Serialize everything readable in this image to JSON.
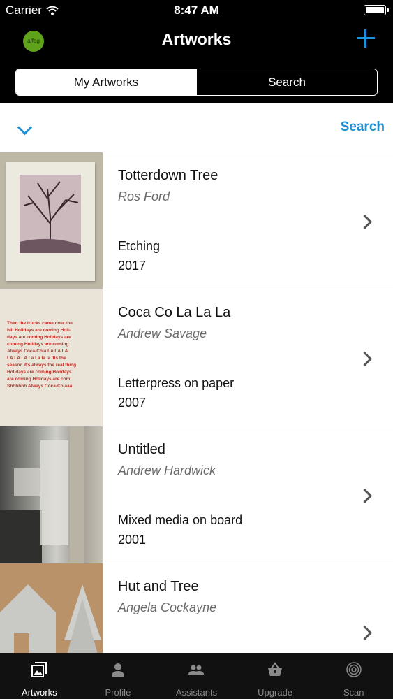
{
  "status_bar": {
    "carrier": "Carrier",
    "time": "8:47 AM"
  },
  "nav": {
    "logo_text": "a/fag",
    "title": "Artworks",
    "segments": [
      "My Artworks",
      "Search"
    ],
    "accent_color": "#1e8fd0"
  },
  "filter_row": {
    "search_label": "Search"
  },
  "artworks": [
    {
      "title": "Totterdown Tree",
      "artist": "Ros Ford",
      "medium": "Etching",
      "year": "2017"
    },
    {
      "title": "Coca Co La La La",
      "artist": "Andrew Savage",
      "medium": "Letterpress on paper",
      "year": "2007",
      "thumbnail_text": [
        "Then the trucks came over the",
        "hill Holidays are coming Holi-",
        "days are coming Holidays are",
        "coming Holidays are coming",
        "Always Coca-Cola LA LA LA",
        "LA LA LA La La la la 'tis the",
        "season it's always the real thing",
        "Holidays are coming Holidays",
        "are coming Holidays are com",
        "Shhhhhh Always Coca-Colaaa"
      ]
    },
    {
      "title": "Untitled",
      "artist": "Andrew Hardwick",
      "medium": "Mixed media on board",
      "year": "2001"
    },
    {
      "title": "Hut and Tree",
      "artist": "Angela Cockayne",
      "medium": "",
      "year": ""
    }
  ],
  "tabs": [
    {
      "label": "Artworks",
      "icon": "artworks-icon",
      "active": true
    },
    {
      "label": "Profile",
      "icon": "profile-icon",
      "active": false
    },
    {
      "label": "Assistants",
      "icon": "assistants-icon",
      "active": false
    },
    {
      "label": "Upgrade",
      "icon": "upgrade-basket-icon",
      "active": false
    },
    {
      "label": "Scan",
      "icon": "scan-icon",
      "active": false
    }
  ]
}
